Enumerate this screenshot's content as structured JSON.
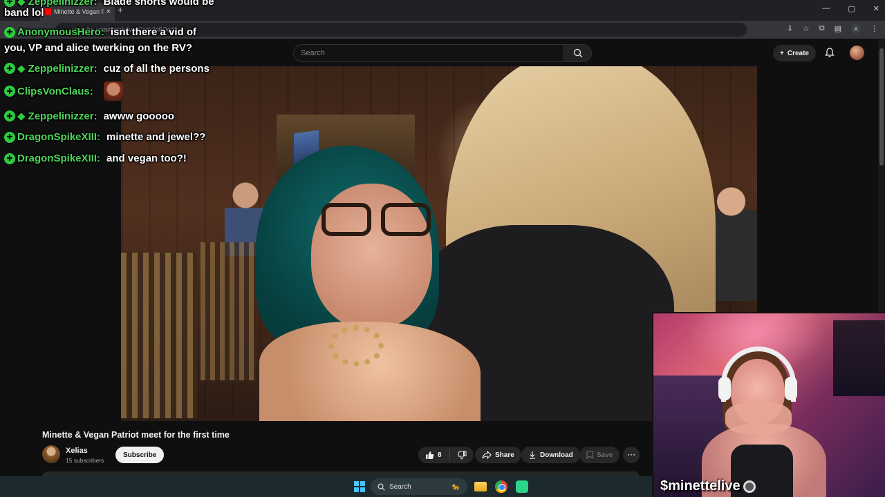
{
  "browser": {
    "tab_title": "Minette & Vegan Patriot m",
    "tab_close": "×",
    "new_tab": "+",
    "url": "youtube.com/watch?v=rCsjrk3o5Oq4u",
    "window_controls": {
      "minimize": "—",
      "maximize": "▢",
      "close": "✕"
    },
    "profile_initial": "A"
  },
  "youtube": {
    "search_placeholder": "Search",
    "create_label": "Create",
    "video_title": "Minette & Vegan Patriot meet for the first time",
    "channel": {
      "name": "Xelias",
      "subscribers": "15 subscribers"
    },
    "subscribe_label": "Subscribe",
    "like_count": "8",
    "share_label": "Share",
    "download_label": "Download",
    "save_label": "Save",
    "more_label": "⋯"
  },
  "chat": {
    "lines": [
      {
        "user": "Zeppelinizzer:",
        "message": "Blade shorts would be",
        "badge": true,
        "diamond": true
      },
      {
        "continuation": "band lol"
      },
      {
        "user": "AnonymousHero:",
        "message": "isnt there a vid of",
        "badge": true,
        "diamond": false
      },
      {
        "continuation": "you, VP and alice twerking on the RV?"
      },
      {
        "user": "Zeppelinizzer:",
        "message": "cuz of all the persons",
        "badge": true,
        "diamond": true
      },
      {
        "user": "ClipsVonClaus:",
        "message": "",
        "badge": true,
        "diamond": false,
        "emote": true
      },
      {
        "user": "Zeppelinizzer:",
        "message": "awww gooooo",
        "badge": true,
        "diamond": true
      },
      {
        "user": "DragonSpikeXIII:",
        "message": "minette and jewel??",
        "badge": true,
        "diamond": false
      },
      {
        "user": "DragonSpikeXIII:",
        "message": "and vegan too?!",
        "badge": true,
        "diamond": false
      }
    ]
  },
  "webcam": {
    "handle": "$minettelive"
  },
  "taskbar": {
    "search_label": "Search"
  },
  "colors": {
    "chat_username": "#4cd45a",
    "badge": "#2ecc40",
    "yt_bg": "#0f0f0f",
    "pill_bg": "#272727"
  }
}
